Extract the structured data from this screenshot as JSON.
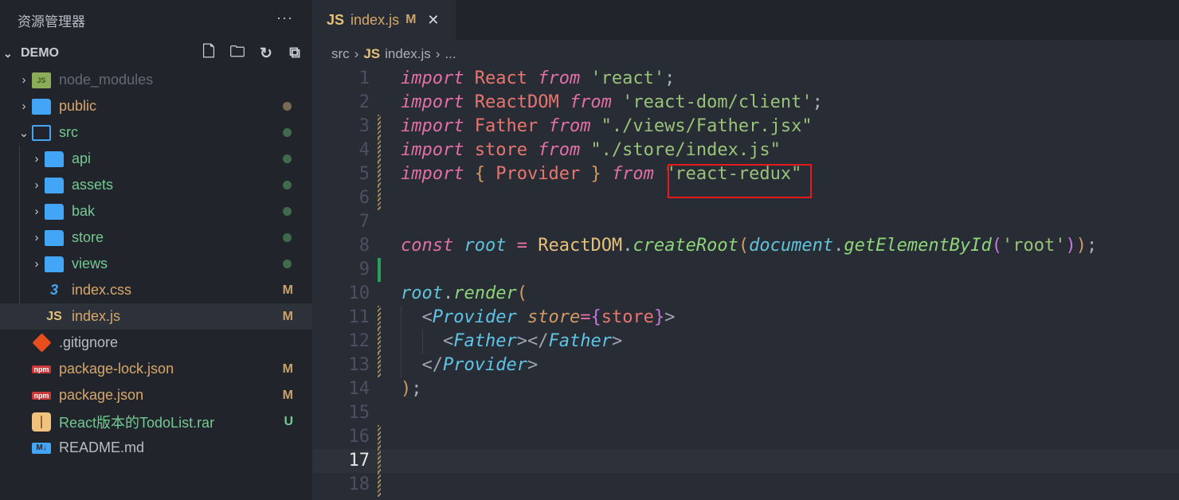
{
  "sidebar": {
    "title": "资源管理器",
    "more": "···",
    "project": "DEMO",
    "actions": [
      {
        "name": "new-file",
        "glyph": "🗋"
      },
      {
        "name": "new-folder",
        "glyph": "🗀"
      },
      {
        "name": "refresh",
        "glyph": "↻"
      },
      {
        "name": "collapse-all",
        "glyph": "⧉"
      }
    ],
    "items": [
      {
        "label": "node_modules",
        "depth": 0,
        "kind": "folder-node",
        "chev": "›",
        "color": "#636a75"
      },
      {
        "label": "public",
        "depth": 0,
        "kind": "folder",
        "chev": "›",
        "color": "#d7a76a",
        "dot": "#7a6a55"
      },
      {
        "label": "src",
        "depth": 0,
        "kind": "folder-open",
        "chev": "⌄",
        "color": "#73c991",
        "dot": "#3f6a4c"
      },
      {
        "label": "api",
        "depth": 1,
        "kind": "folder",
        "chev": "›",
        "color": "#73c991",
        "dot": "#3f6a4c"
      },
      {
        "label": "assets",
        "depth": 1,
        "kind": "folder",
        "chev": "›",
        "color": "#73c991",
        "dot": "#3f6a4c"
      },
      {
        "label": "bak",
        "depth": 1,
        "kind": "folder",
        "chev": "›",
        "color": "#73c991",
        "dot": "#3f6a4c"
      },
      {
        "label": "store",
        "depth": 1,
        "kind": "folder",
        "chev": "›",
        "color": "#73c991",
        "dot": "#3f6a4c"
      },
      {
        "label": "views",
        "depth": 1,
        "kind": "folder",
        "chev": "›",
        "color": "#73c991",
        "dot": "#3f6a4c"
      },
      {
        "label": "index.css",
        "depth": 1,
        "kind": "css",
        "color": "#d7a76a",
        "badge": "M"
      },
      {
        "label": "index.js",
        "depth": 1,
        "kind": "js",
        "color": "#d7a76a",
        "badge": "M",
        "selected": true
      },
      {
        "label": ".gitignore",
        "depth": 0,
        "kind": "git",
        "color": "#b7bcc6"
      },
      {
        "label": "package-lock.json",
        "depth": 0,
        "kind": "npm",
        "color": "#d7a76a",
        "badge": "M"
      },
      {
        "label": "package.json",
        "depth": 0,
        "kind": "npm",
        "color": "#d7a76a",
        "badge": "M"
      },
      {
        "label": "React版本的TodoList.rar",
        "depth": 0,
        "kind": "zip",
        "color": "#73c991",
        "badge": "U",
        "badge_color": "#73c991"
      },
      {
        "label": "README.md",
        "depth": 0,
        "kind": "md",
        "color": "#b7bcc6"
      }
    ],
    "icon_text": {
      "js": "JS",
      "npm": "npm",
      "md": "M↓",
      "css": "3",
      "node": "JS"
    }
  },
  "tab": {
    "icon": "JS",
    "label": "index.js",
    "badge": "M",
    "close": "✕"
  },
  "breadcrumb": {
    "items": [
      "src",
      "index.js",
      "..."
    ],
    "sep": "›",
    "icon": "JS"
  },
  "code": {
    "current_line": 17,
    "lines": [
      {
        "n": "1",
        "t": [
          [
            "import",
            "kw"
          ],
          [
            " React ",
            "id"
          ],
          [
            "from",
            "kw"
          ],
          [
            " 'react'",
            "str"
          ],
          [
            ";",
            "pn"
          ]
        ]
      },
      {
        "n": "2",
        "t": [
          [
            "import",
            "kw"
          ],
          [
            " ReactDOM ",
            "id"
          ],
          [
            "from",
            "kw"
          ],
          [
            " 'react-dom/client'",
            "str"
          ],
          [
            ";",
            "pn"
          ]
        ]
      },
      {
        "n": "3",
        "g": "mod",
        "t": [
          [
            "import",
            "kw"
          ],
          [
            " Father ",
            "id"
          ],
          [
            "from",
            "kw"
          ],
          [
            " \"./views/Father.jsx\"",
            "str"
          ]
        ]
      },
      {
        "n": "4",
        "g": "mod",
        "t": [
          [
            "import",
            "kw"
          ],
          [
            " store ",
            "id"
          ],
          [
            "from",
            "kw"
          ],
          [
            " \"./store/index.js\"",
            "str"
          ]
        ]
      },
      {
        "n": "5",
        "g": "mod",
        "t": [
          [
            "import",
            "kw"
          ],
          [
            " ",
            "pn"
          ],
          [
            "{",
            "br"
          ],
          [
            " Provider ",
            "id"
          ],
          [
            "}",
            "br"
          ],
          [
            " ",
            "pn"
          ],
          [
            "from",
            "kw"
          ],
          [
            " \"react-redux\"",
            "str"
          ]
        ]
      },
      {
        "n": "6",
        "g": "mod",
        "t": []
      },
      {
        "n": "7",
        "t": []
      },
      {
        "n": "8",
        "t": [
          [
            "const",
            "kw"
          ],
          [
            " ",
            "pn"
          ],
          [
            "root",
            "var"
          ],
          [
            " = ",
            "kw"
          ],
          [
            "ReactDOM",
            "cls"
          ],
          [
            ".",
            "pn"
          ],
          [
            "createRoot",
            "fn"
          ],
          [
            "(",
            "br"
          ],
          [
            "document",
            "var"
          ],
          [
            ".",
            "pn"
          ],
          [
            "getElementById",
            "fn"
          ],
          [
            "(",
            "par"
          ],
          [
            "'root'",
            "str"
          ],
          [
            ")",
            "par"
          ],
          [
            ")",
            "br"
          ],
          [
            ";",
            "pn"
          ]
        ]
      },
      {
        "n": "9",
        "g": "add",
        "t": []
      },
      {
        "n": "10",
        "t": [
          [
            "root",
            "var"
          ],
          [
            ".",
            "pn"
          ],
          [
            "render",
            "fn"
          ],
          [
            "(",
            "br"
          ]
        ]
      },
      {
        "n": "11",
        "g": "mod",
        "ig": [
          1
        ],
        "t": [
          [
            "  ",
            "pn"
          ],
          [
            "<",
            "tag"
          ],
          [
            "Provider",
            "comp"
          ],
          [
            " ",
            "pn"
          ],
          [
            "store",
            "attr"
          ],
          [
            "=",
            "kw"
          ],
          [
            "{",
            "par"
          ],
          [
            "store",
            "id"
          ],
          [
            "}",
            "par"
          ],
          [
            ">",
            "tag"
          ]
        ]
      },
      {
        "n": "12",
        "g": "mod",
        "ig": [
          1,
          2
        ],
        "t": [
          [
            "    ",
            "pn"
          ],
          [
            "<",
            "tag"
          ],
          [
            "Father",
            "comp"
          ],
          [
            "></",
            "tag"
          ],
          [
            "Father",
            "comp"
          ],
          [
            ">",
            "tag"
          ]
        ]
      },
      {
        "n": "13",
        "g": "mod",
        "ig": [
          1
        ],
        "t": [
          [
            "  ",
            "pn"
          ],
          [
            "</",
            "tag"
          ],
          [
            "Provider",
            "comp"
          ],
          [
            ">",
            "tag"
          ]
        ]
      },
      {
        "n": "14",
        "t": [
          [
            ")",
            "br"
          ],
          [
            ";",
            "pn"
          ]
        ]
      },
      {
        "n": "15",
        "t": []
      },
      {
        "n": "16",
        "g": "mod",
        "t": []
      },
      {
        "n": "17",
        "g": "mod",
        "t": []
      },
      {
        "n": "18",
        "g": "mod",
        "t": []
      }
    ]
  }
}
